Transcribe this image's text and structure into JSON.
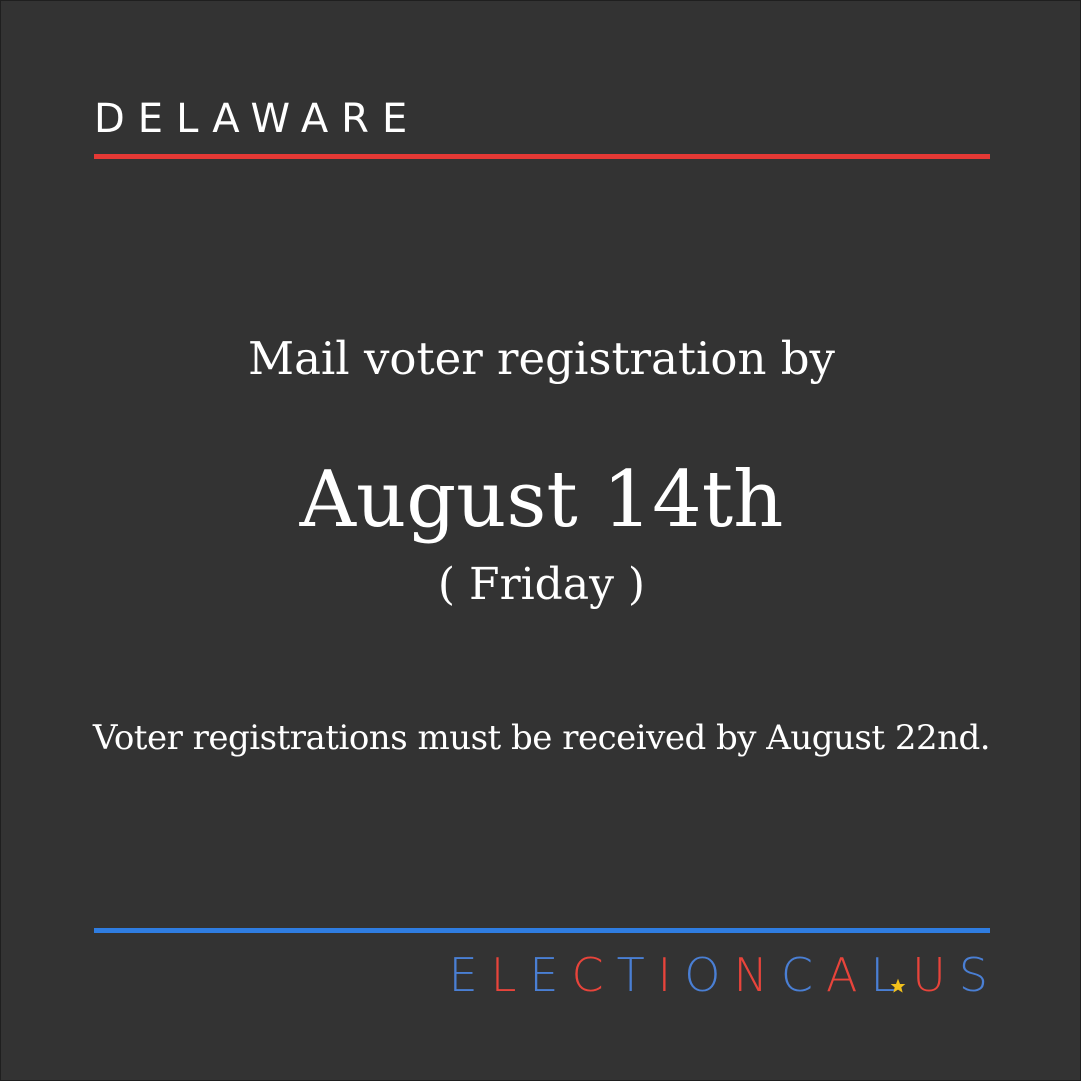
{
  "state": "DELAWARE",
  "headline": "Mail voter registration by",
  "deadline_date": "August 14th",
  "deadline_weekday": "( Friday )",
  "note": "Voter registrations must be received by August 22nd.",
  "brand": {
    "letters": [
      "E",
      "L",
      "E",
      "C",
      "T",
      "I",
      "O",
      "N",
      "C",
      "A",
      "L"
    ],
    "tld_letters": [
      "U",
      "S"
    ],
    "icon": "star-icon"
  },
  "colors": {
    "background": "#333333",
    "top_rule": "#e53935",
    "bottom_rule": "#2f7de1",
    "brand_red": "#e8443b",
    "brand_blue": "#4a7fd4",
    "star": "#f2c11c",
    "text": "#ffffff"
  }
}
